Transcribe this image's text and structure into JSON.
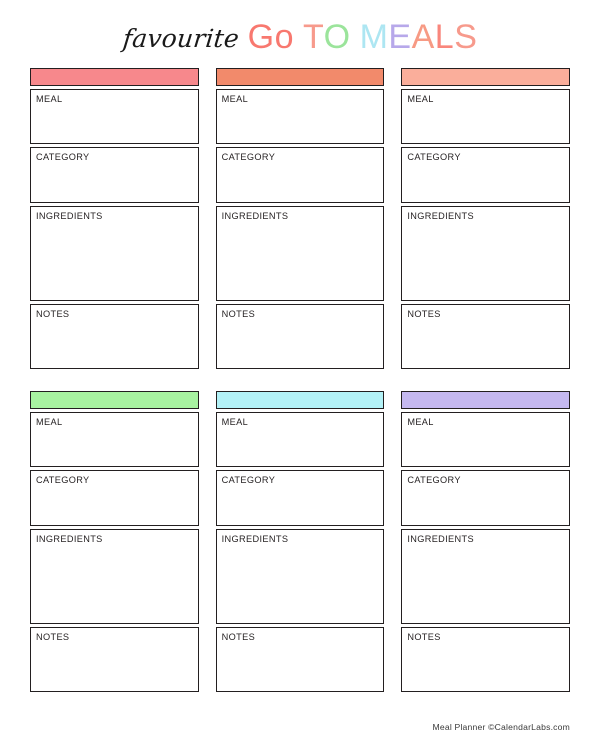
{
  "page": {
    "title_script": "favourite",
    "title_letters": [
      {
        "char": "G",
        "color": "#F8786F"
      },
      {
        "char": "o",
        "color": "#F8786F"
      },
      {
        "char": " ",
        "color": "#FFFFFF"
      },
      {
        "char": "T",
        "color": "#F79A8C"
      },
      {
        "char": "O",
        "color": "#9BE49B"
      },
      {
        "char": " ",
        "color": "#FFFFFF"
      },
      {
        "char": "M",
        "color": "#ADE6F2"
      },
      {
        "char": "E",
        "color": "#B7A8EA"
      },
      {
        "char": "A",
        "color": "#F79A84"
      },
      {
        "char": "L",
        "color": "#F9867C"
      },
      {
        "char": "S",
        "color": "#F79A8C"
      }
    ],
    "footer": "Meal Planner ©CalendarLabs.com",
    "border_color": "#231f20"
  },
  "field_labels": {
    "meal": "MEAL",
    "category": "CATEGORY",
    "ingredients": "INGREDIENTS",
    "notes": "NOTES"
  },
  "cards": [
    {
      "id": "card-1",
      "header_color": "#F7888C",
      "meal": "",
      "category": "",
      "ingredients": "",
      "notes": ""
    },
    {
      "id": "card-2",
      "header_color": "#F28A6B",
      "meal": "",
      "category": "",
      "ingredients": "",
      "notes": ""
    },
    {
      "id": "card-3",
      "header_color": "#FAAE9B",
      "meal": "",
      "category": "",
      "ingredients": "",
      "notes": ""
    },
    {
      "id": "card-4",
      "header_color": "#A8F3A1",
      "meal": "",
      "category": "",
      "ingredients": "",
      "notes": ""
    },
    {
      "id": "card-5",
      "header_color": "#B3F2F7",
      "meal": "",
      "category": "",
      "ingredients": "",
      "notes": ""
    },
    {
      "id": "card-6",
      "header_color": "#C5B8F0",
      "meal": "",
      "category": "",
      "ingredients": "",
      "notes": ""
    }
  ]
}
